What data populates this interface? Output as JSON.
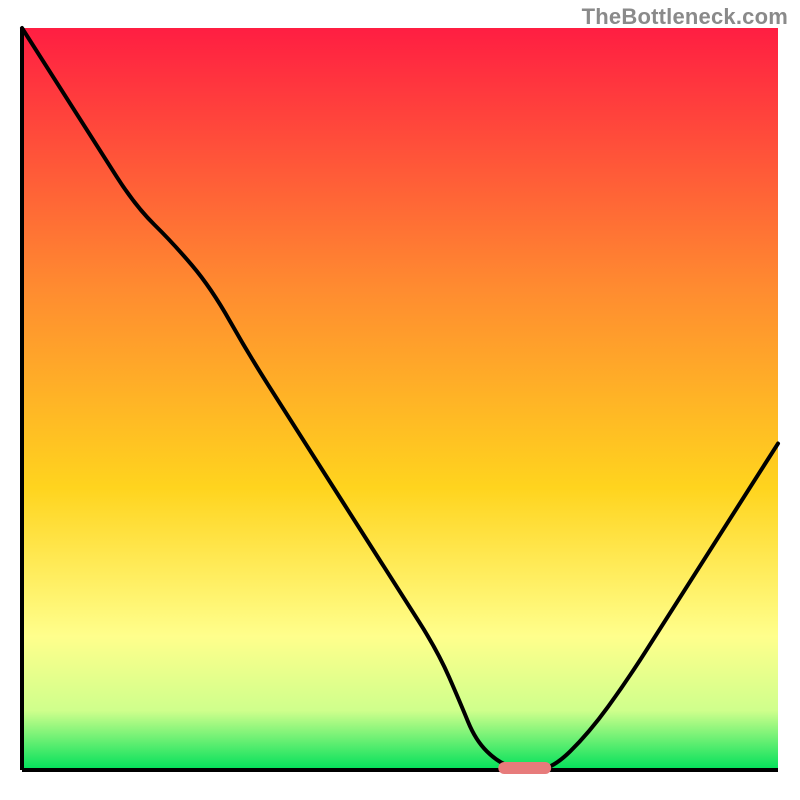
{
  "watermark": "TheBottleneck.com",
  "colors": {
    "axis": "#000000",
    "line": "#000000",
    "marker_fill": "#e77b7b",
    "gradient": {
      "top": "#ff1e42",
      "mid_up": "#ff8b30",
      "mid": "#ffd41e",
      "lower": "#ffff8c",
      "band": "#cfff8c",
      "bottom": "#00e05a"
    }
  },
  "chart_data": {
    "type": "line",
    "title": "",
    "xlabel": "",
    "ylabel": "",
    "xlim": [
      0,
      100
    ],
    "ylim": [
      0,
      100
    ],
    "grid": false,
    "legend": null,
    "x": [
      0,
      5,
      10,
      15,
      20,
      25,
      30,
      35,
      40,
      45,
      50,
      55,
      58,
      60,
      63,
      66,
      70,
      75,
      80,
      85,
      90,
      95,
      100
    ],
    "y": [
      100,
      92,
      84,
      76,
      71,
      65,
      56,
      48,
      40,
      32,
      24,
      16,
      9,
      4,
      1,
      0,
      0,
      5,
      12,
      20,
      28,
      36,
      44
    ],
    "marker": {
      "x_start": 63,
      "x_end": 70,
      "y": 0
    },
    "note": "Values estimated from pixel positions; y is a relative percentage (0 = bottom axis, 100 = top of plot area). Curve descends from top-left, reaches a minimum near x≈66, then rises toward the right edge."
  }
}
